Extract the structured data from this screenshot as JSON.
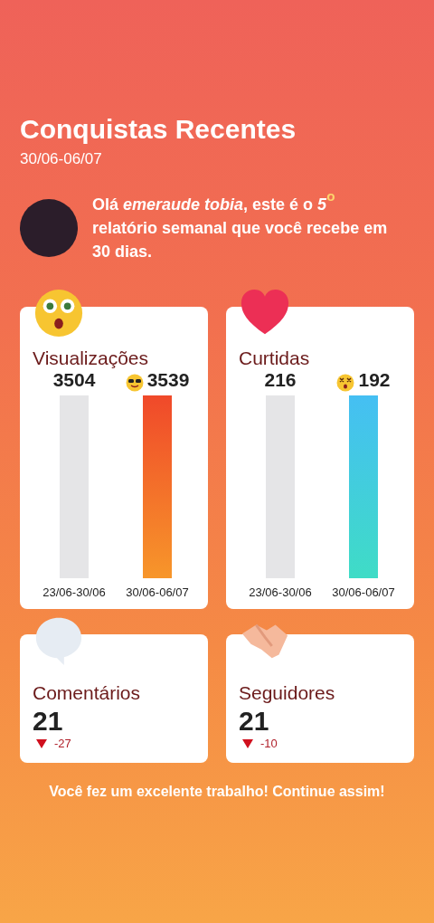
{
  "header": {
    "title": "Conquistas Recentes",
    "date_range": "30/06-06/07"
  },
  "greeting": {
    "text": "Olá *emeraude tobia*, este é o *5*$^{o}$ relatório semanal que você recebe em 30 dias."
  },
  "stat_cards": [
    {
      "kind": "bars",
      "title": "Visualizações",
      "previous": {
        "value": "3504",
        "label": "23/06-30/06"
      },
      "current": {
        "value": "3539",
        "label": "30/06-06/07"
      }
    },
    {
      "kind": "bars",
      "title": "Curtidas",
      "previous": {
        "value": "216",
        "label": "23/06-30/06"
      },
      "current": {
        "value": "192",
        "label": "30/06-06/07"
      }
    },
    {
      "kind": "count",
      "title": "Comentários",
      "value": "21",
      "change": "-27"
    },
    {
      "kind": "count",
      "title": "Seguidores",
      "value": "21",
      "change": "-10"
    }
  ],
  "footer": {
    "text": "Você fez um excelente trabalho! Continue assim!"
  }
}
